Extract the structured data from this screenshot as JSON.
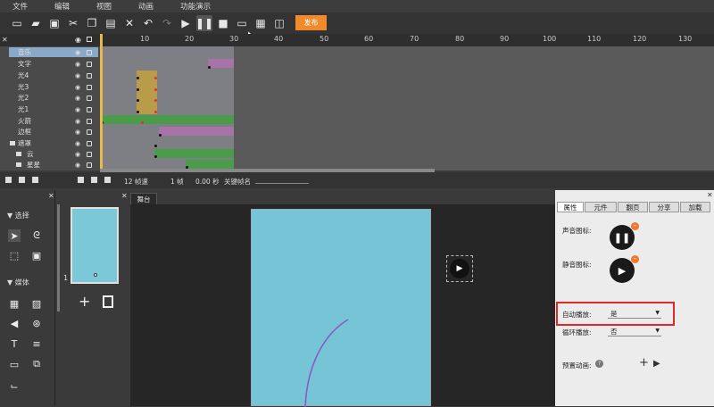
{
  "menu": [
    "文件",
    "编辑",
    "视图",
    "动画",
    "功能演示"
  ],
  "toolbar": {
    "publish_label": "发布"
  },
  "ruler": {
    "ticks": [
      "10",
      "20",
      "30",
      "40",
      "50",
      "60",
      "70",
      "80",
      "90",
      "100",
      "110",
      "120",
      "130"
    ]
  },
  "layers": [
    {
      "name": "音乐",
      "active": true
    },
    {
      "name": "文字"
    },
    {
      "name": "光4"
    },
    {
      "name": "光3"
    },
    {
      "name": "光2"
    },
    {
      "name": "光1"
    },
    {
      "name": "火箭"
    },
    {
      "name": "边框"
    },
    {
      "name": "遮罩"
    },
    {
      "name": "云"
    },
    {
      "name": "星星"
    }
  ],
  "status": {
    "fps": "12 帧速",
    "frame": "1 帧",
    "time": "0.00 秒",
    "keyframe_label": "关键帧名"
  },
  "left_panel": {
    "section_select": "选择",
    "section_media": "媒体"
  },
  "page_panel": {
    "page_number": "1",
    "add_icon": "+"
  },
  "stage": {
    "tab_label": "舞台"
  },
  "right_panel": {
    "tabs": [
      "属性",
      "元件",
      "翻页",
      "分享",
      "加载"
    ],
    "sound_icon_label": "声音图标:",
    "mute_icon_label": "静音图标:",
    "autoplay_label": "自动播放:",
    "autoplay_value": "是",
    "loop_label": "循环播放:",
    "loop_value": "否",
    "preset_anim_label": "预置动画:"
  },
  "colors": {
    "publish": "#f08a2a",
    "canvas": "#76c5d6",
    "highlight": "#e02828",
    "purple": "#a873a8",
    "green": "#4a9c4a",
    "yellow": "#b89c4a"
  }
}
